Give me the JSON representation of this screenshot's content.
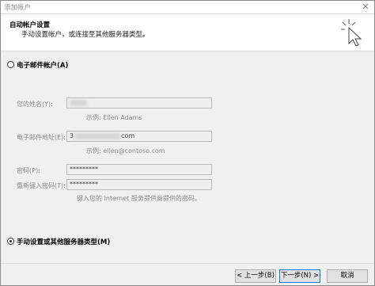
{
  "window": {
    "title": "添加帐户",
    "close_glyph": "✕"
  },
  "header": {
    "title": "自动帐户设置",
    "subtitle": "手动设置帐户，或连接至其他服务器类型。",
    "icon": "cursor-click-icon"
  },
  "option_email": {
    "label": "电子邮件帐户(A)",
    "selected": false
  },
  "form": {
    "name": {
      "label": "您的姓名(Y):",
      "value": "",
      "hint": "示例: Ellen Adams"
    },
    "email": {
      "label": "电子邮件地址(E):",
      "value_prefix": "3",
      "value_suffix": "com",
      "hint": "示例: ellen@contoso.com"
    },
    "password": {
      "label": "密码(P):",
      "value": "*********"
    },
    "retype_password": {
      "label": "重新键入密码(T):",
      "value": "*********"
    },
    "password_hint": "键入您的 Internet 服务提供商提供的密码。"
  },
  "option_manual": {
    "label": "手动设置或其他服务器类型(M)",
    "selected": true
  },
  "buttons": {
    "back": "< 上一步(B)",
    "next": "下一步(N) >",
    "cancel": "取消"
  }
}
